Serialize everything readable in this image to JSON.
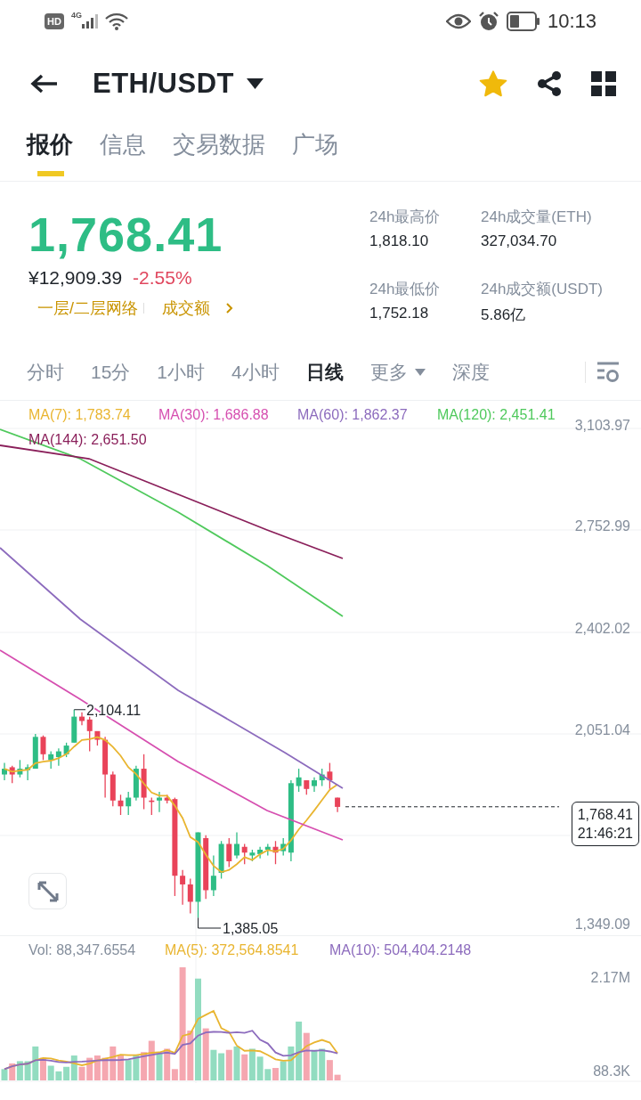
{
  "status_bar": {
    "hd": "HD",
    "network": "4G",
    "time": "10:13"
  },
  "header": {
    "pair": "ETH/USDT",
    "favorite": true
  },
  "tabs": [
    {
      "label": "报价",
      "selected": true
    },
    {
      "label": "信息",
      "selected": false
    },
    {
      "label": "交易数据",
      "selected": false
    },
    {
      "label": "广场",
      "selected": false
    }
  ],
  "ticker": {
    "price": "1,768.41",
    "fiat": "¥12,909.39",
    "change": "-2.55%",
    "tags": [
      "一层/二层网络",
      "成交额"
    ],
    "stats": [
      {
        "label": "24h最高价",
        "value": "1,818.10"
      },
      {
        "label": "24h成交量(ETH)",
        "value": "327,034.70"
      },
      {
        "label": "24h最低价",
        "value": "1,752.18"
      },
      {
        "label": "24h成交额(USDT)",
        "value": "5.86亿"
      }
    ]
  },
  "intervals": [
    {
      "label": "分时",
      "selected": false,
      "kind": "plain"
    },
    {
      "label": "15分",
      "selected": false,
      "kind": "plain"
    },
    {
      "label": "1小时",
      "selected": false,
      "kind": "plain"
    },
    {
      "label": "4小时",
      "selected": false,
      "kind": "plain"
    },
    {
      "label": "日线",
      "selected": true,
      "kind": "plain"
    },
    {
      "label": "更多",
      "selected": false,
      "kind": "menu"
    },
    {
      "label": "深度",
      "selected": false,
      "kind": "plain"
    }
  ],
  "chart": {
    "legend": [
      {
        "label": "MA(7): 1,783.74",
        "color": "#e9b530"
      },
      {
        "label": "MA(30): 1,686.88",
        "color": "#d64fb0"
      },
      {
        "label": "MA(60): 1,862.37",
        "color": "#8c6bbd"
      },
      {
        "label": "MA(120): 2,451.41",
        "color": "#4fc95c"
      },
      {
        "label": "MA(144): 2,651.50",
        "color": "#8a1f5a"
      }
    ],
    "y_axis": [
      "3,103.97",
      "2,752.99",
      "2,402.02",
      "2,051.04",
      "1,349.09"
    ],
    "high_label": "2,104.11",
    "low_label": "1,385.05",
    "last_price": "1,768.41",
    "countdown": "21:46:21"
  },
  "volume": {
    "legend": [
      {
        "label": "Vol: 88,347.6554",
        "color": "#848e9c"
      },
      {
        "label": "MA(5): 372,564.8541",
        "color": "#e9b530"
      },
      {
        "label": "MA(10): 504,404.2148",
        "color": "#8c6bbd"
      }
    ],
    "y_axis": [
      "2.17M",
      "88.3K"
    ]
  }
}
